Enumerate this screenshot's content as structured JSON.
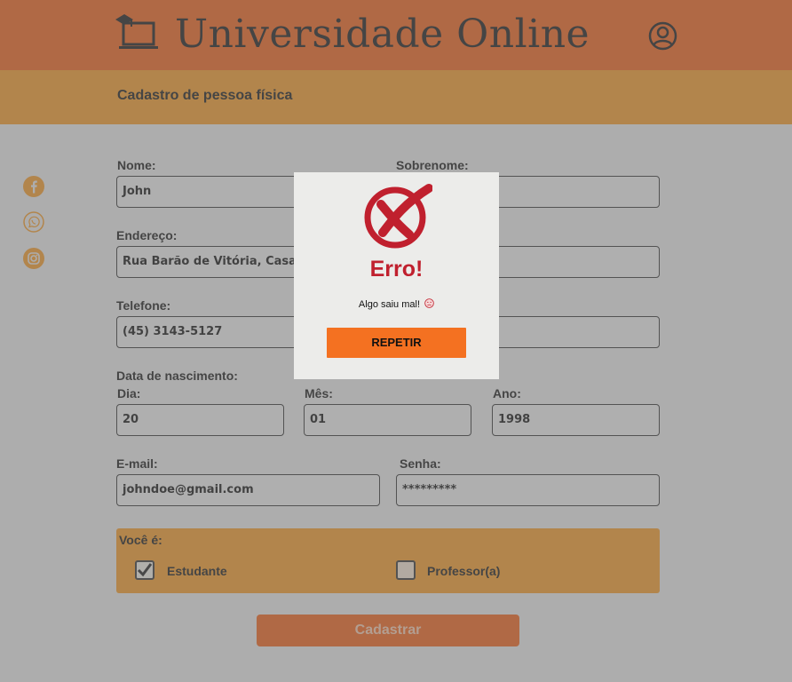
{
  "header": {
    "app_title": "Universidade Online",
    "logo_icon": "laptop-graduation-cap-icon",
    "user_icon": "user-circle-icon"
  },
  "subheader": {
    "title": "Cadastro de pessoa física"
  },
  "social": [
    "facebook-icon",
    "whatsapp-icon",
    "instagram-icon"
  ],
  "form": {
    "nome": {
      "label": "Nome:",
      "value": "John"
    },
    "sobrenome": {
      "label": "Sobrenome:",
      "value": ""
    },
    "endereco": {
      "label": "Endereço:",
      "value": "Rua Barão de Vitória, Casa Gran"
    },
    "telefone": {
      "label": "Telefone:",
      "value": "(45) 3143-5127"
    },
    "nascimento": {
      "label": "Data de nascimento:",
      "dia": {
        "label": "Dia:",
        "value": "20"
      },
      "mes": {
        "label": "Mês:",
        "value": "01"
      },
      "ano": {
        "label": "Ano:",
        "value": "1998"
      }
    },
    "email": {
      "label": "E-mail:",
      "value": "johndoe@gmail.com"
    },
    "senha": {
      "label": "Senha:",
      "value": "*********"
    },
    "role": {
      "label": "Você é:",
      "options": [
        {
          "label": "Estudante",
          "checked": true
        },
        {
          "label": "Professor(a)",
          "checked": false
        }
      ]
    },
    "submit_label": "Cadastrar"
  },
  "modal": {
    "icon": "error-x-circle-icon",
    "title": "Erro!",
    "message": "Algo saiu mal!",
    "message_icon": "sad-face-icon",
    "button_label": "REPETIR"
  },
  "colors": {
    "header": "#f07a3e",
    "subheader": "#f3a94a",
    "error_red": "#c0202e",
    "retry_orange": "#f47121"
  }
}
